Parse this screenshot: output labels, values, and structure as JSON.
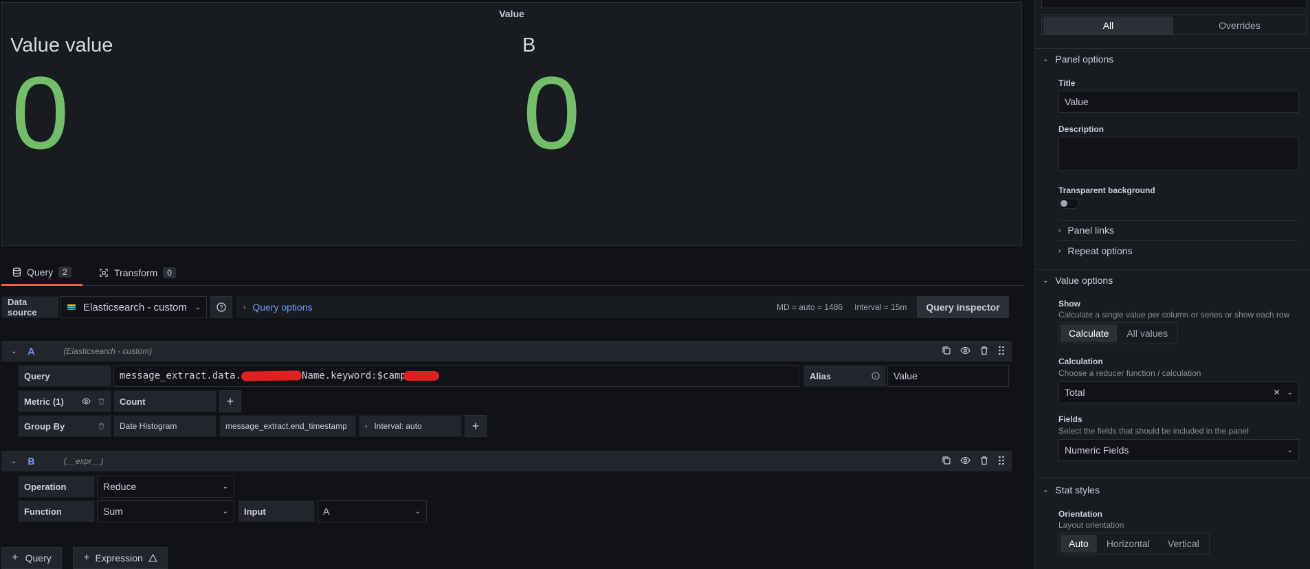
{
  "panel": {
    "title": "Value",
    "stats": [
      {
        "name": "Value value",
        "value": "0"
      },
      {
        "name": "B",
        "value": "0"
      }
    ]
  },
  "tabs": [
    {
      "label": "Query",
      "count": "2"
    },
    {
      "label": "Transform",
      "count": "0"
    }
  ],
  "toolbar": {
    "datasource_label": "Data source",
    "datasource_value": "Elasticsearch - custom",
    "query_options_label": "Query options",
    "md_info": "MD = auto = 1486",
    "interval_info": "Interval = 15m",
    "inspector_label": "Query inspector"
  },
  "queryA": {
    "ref": "A",
    "datasource": "(Elasticsearch - custom)",
    "query_label": "Query",
    "query_prefix": "message_extract.data.",
    "query_middle": "Name.keyword:$camp",
    "alias_label": "Alias",
    "alias_value": "Value",
    "metric_label": "Metric (1)",
    "metric_value": "Count",
    "groupby_label": "Group By",
    "groupby_type": "Date Histogram",
    "groupby_field": "message_extract.end_timestamp",
    "groupby_interval": "Interval: auto"
  },
  "queryB": {
    "ref": "B",
    "datasource": "(__expr__)",
    "operation_label": "Operation",
    "operation_value": "Reduce",
    "function_label": "Function",
    "function_value": "Sum",
    "input_label": "Input",
    "input_value": "A"
  },
  "bottom": {
    "add_query": "Query",
    "add_expression": "Expression"
  },
  "options": {
    "tab_all": "All",
    "tab_overrides": "Overrides",
    "panel_options": {
      "title": "Panel options",
      "title_label": "Title",
      "title_value": "Value",
      "description_label": "Description",
      "transparent_label": "Transparent background",
      "panel_links": "Panel links",
      "repeat_options": "Repeat options"
    },
    "value_options": {
      "title": "Value options",
      "show_label": "Show",
      "show_desc": "Calculate a single value per column or series or show each row",
      "show_opts": [
        "Calculate",
        "All values"
      ],
      "calc_label": "Calculation",
      "calc_desc": "Choose a reducer function / calculation",
      "calc_value": "Total",
      "fields_label": "Fields",
      "fields_desc": "Select the fields that should be included in the panel",
      "fields_value": "Numeric Fields"
    },
    "stat_styles": {
      "title": "Stat styles",
      "orientation_label": "Orientation",
      "orientation_desc": "Layout orientation",
      "orientation_opts": [
        "Auto",
        "Horizontal",
        "Vertical"
      ]
    }
  },
  "colors": {
    "stat_green": "#73bf69",
    "accent_orange": "#f55f3e",
    "link_blue": "#6e9fff",
    "redaction_red": "#e02020"
  }
}
